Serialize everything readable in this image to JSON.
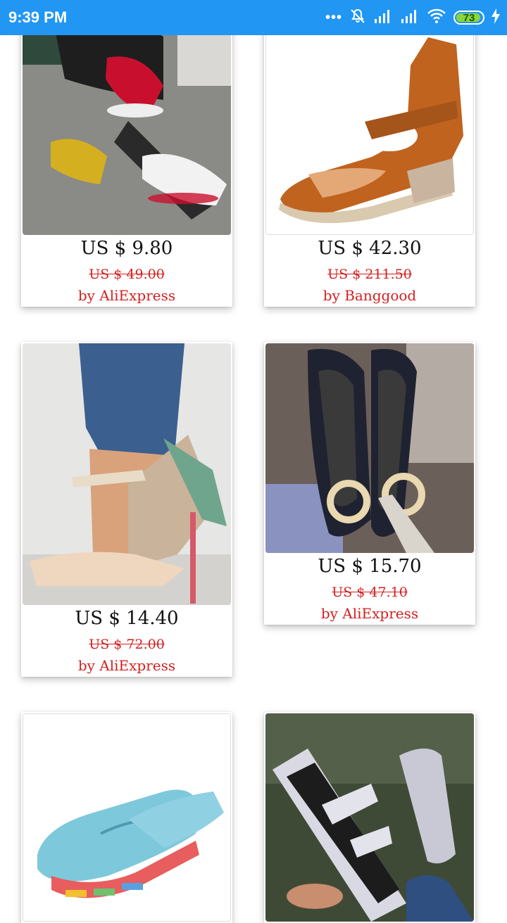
{
  "status_bar": {
    "time": "9:39 PM",
    "dots": "•••",
    "battery_level": "73",
    "icons": [
      "dots-icon",
      "mute-icon",
      "signal-icon",
      "signal-icon",
      "wifi-icon",
      "battery-icon",
      "charging-icon"
    ]
  },
  "colors": {
    "status_bar": "#2196F3",
    "price_accent": "#d32020",
    "battery_fill": "#8bd63a"
  },
  "products": [
    {
      "image": "sneakers-photo",
      "price": "US $ 9.80",
      "old_price": "US $ 49.00",
      "seller": "by AliExpress"
    },
    {
      "image": "wedge-sandal-photo",
      "price": "US $ 42.30",
      "old_price": "US $ 211.50",
      "seller": "by Banggood"
    },
    {
      "image": "floral-heels-photo",
      "price": "US $ 14.40",
      "old_price": "US $ 72.00",
      "seller": "by AliExpress"
    },
    {
      "image": "tweed-flats-photo",
      "price": "US $ 15.70",
      "old_price": "US $ 47.10",
      "seller": "by AliExpress"
    },
    {
      "image": "blue-loafers-photo",
      "price": "",
      "old_price": "",
      "seller": ""
    },
    {
      "image": "glitter-platform-photo",
      "price": "",
      "old_price": "",
      "seller": ""
    }
  ]
}
